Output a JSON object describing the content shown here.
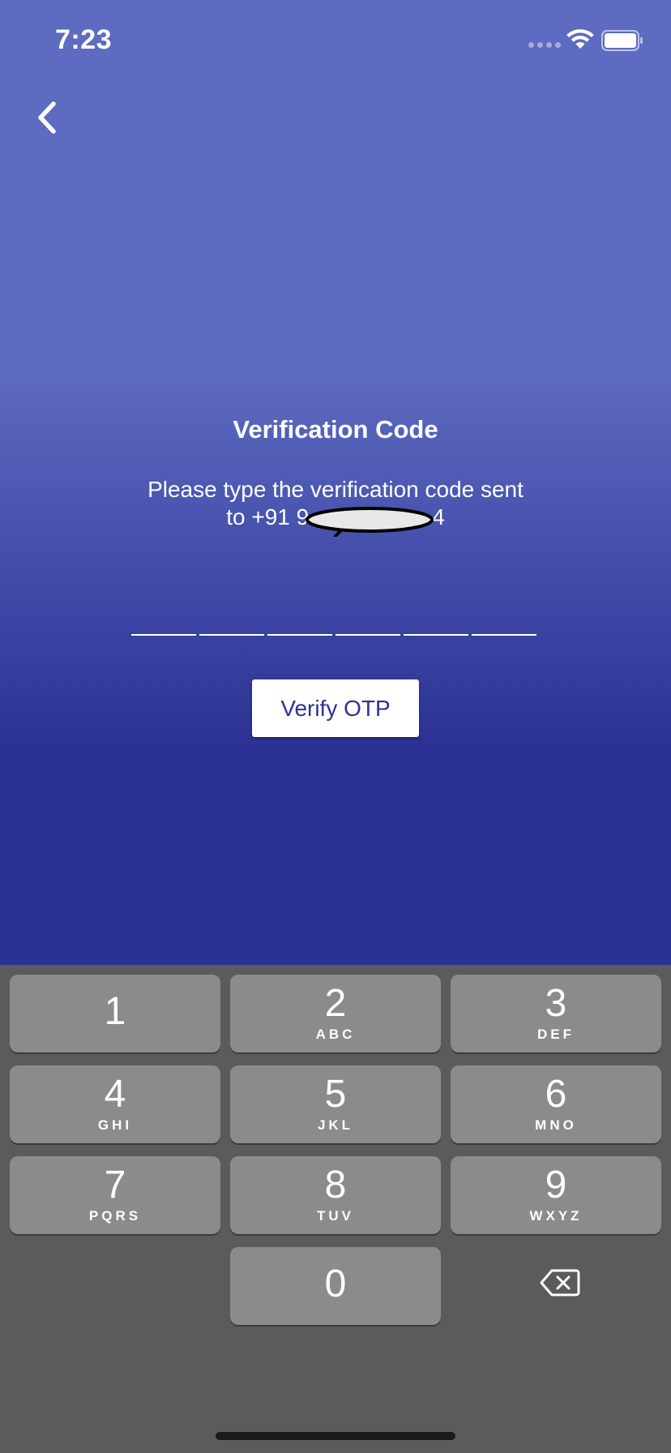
{
  "status_bar": {
    "time": "7:23"
  },
  "header": {
    "back_icon": "chevron-left-icon"
  },
  "content": {
    "title": "Verification Code",
    "subtitle_line1": "Please type the verification code sent",
    "subtitle_line2_visible": "to +91 9",
    "subtitle_line2_tail": "4",
    "otp_length": 6,
    "verify_label": "Verify OTP"
  },
  "keypad": {
    "keys": [
      {
        "digit": "1",
        "letters": ""
      },
      {
        "digit": "2",
        "letters": "ABC"
      },
      {
        "digit": "3",
        "letters": "DEF"
      },
      {
        "digit": "4",
        "letters": "GHI"
      },
      {
        "digit": "5",
        "letters": "JKL"
      },
      {
        "digit": "6",
        "letters": "MNO"
      },
      {
        "digit": "7",
        "letters": "PQRS"
      },
      {
        "digit": "8",
        "letters": "TUV"
      },
      {
        "digit": "9",
        "letters": "WXYZ"
      },
      {
        "digit": "0",
        "letters": ""
      }
    ],
    "delete_icon": "backspace-icon"
  },
  "colors": {
    "gradient_top": "#5d6bc0",
    "gradient_bottom": "#2b3294",
    "keyboard_bg": "#5b5b5b",
    "key_bg": "#8b8b8b",
    "button_text": "#2b3294"
  }
}
